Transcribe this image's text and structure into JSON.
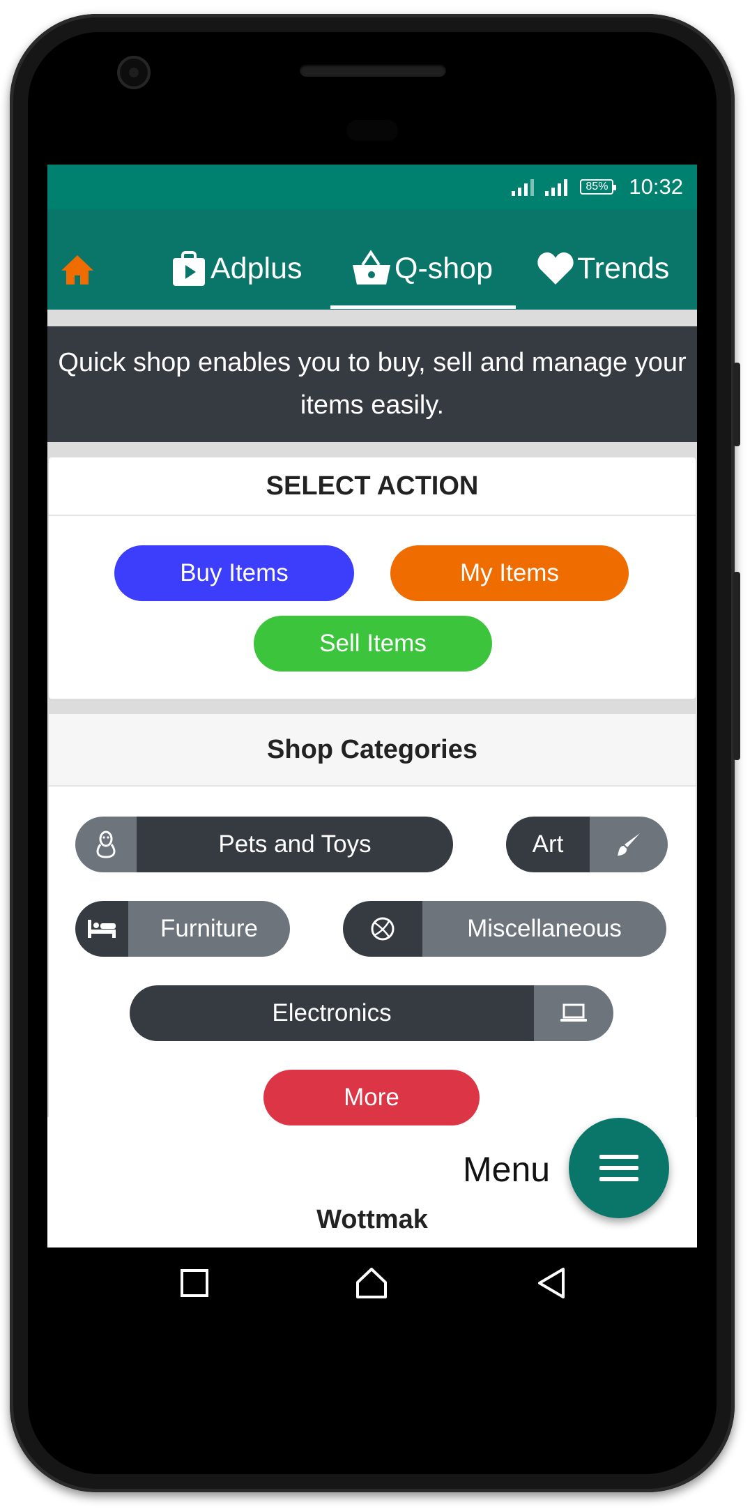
{
  "status_bar": {
    "battery": "85%",
    "time": "10:32"
  },
  "nav": {
    "home_icon": "home-icon",
    "tabs": [
      {
        "label": "Adplus",
        "icon": "play-bag-icon"
      },
      {
        "label": "Q-shop",
        "icon": "basket-icon",
        "active": true
      },
      {
        "label": "Trends",
        "icon": "heart-icon"
      }
    ]
  },
  "banner": {
    "text": "Quick shop enables you to buy, sell and manage your items easily."
  },
  "select_action": {
    "title": "SELECT ACTION",
    "buy": "Buy Items",
    "my": "My Items",
    "sell": "Sell Items"
  },
  "shop_categories": {
    "title": "Shop Categories",
    "items": [
      {
        "label": "Pets and Toys",
        "icon": "linux-icon"
      },
      {
        "label": "Art",
        "icon": "paint-brush-icon"
      },
      {
        "label": "Furniture",
        "icon": "bed-icon"
      },
      {
        "label": "Miscellaneous",
        "icon": "basketball-icon"
      },
      {
        "label": "Electronics",
        "icon": "laptop-icon"
      }
    ],
    "more": "More"
  },
  "fab": {
    "label": "Menu",
    "icon": "hamburger-icon"
  },
  "next_section": {
    "title": "Wottmak"
  },
  "colors": {
    "status_bar": "#00806f",
    "nav_bar": "#0a766a",
    "buy": "#3d3dfc",
    "my": "#ef6c00",
    "sell": "#3cc43c",
    "more": "#dc3545",
    "home_icon": "#ef6c00"
  }
}
